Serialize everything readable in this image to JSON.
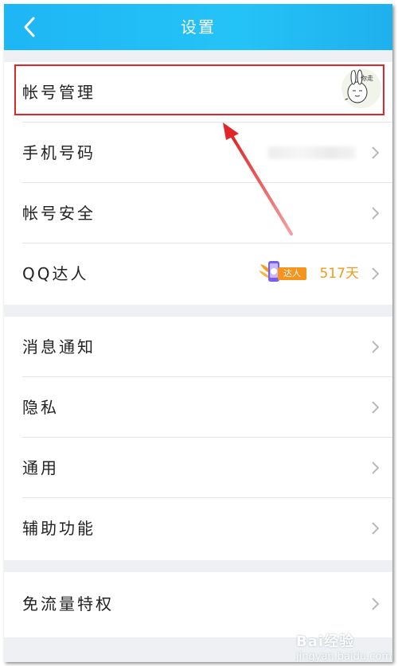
{
  "header": {
    "title": "设置"
  },
  "sections": [
    {
      "rows": [
        {
          "label": "帐号管理",
          "avatar_text": "你走"
        },
        {
          "label": "手机号码"
        },
        {
          "label": "帐号安全"
        },
        {
          "label": "QQ达人",
          "badge_label": "达人",
          "days": "517天"
        }
      ]
    },
    {
      "rows": [
        {
          "label": "消息通知"
        },
        {
          "label": "隐私"
        },
        {
          "label": "通用"
        },
        {
          "label": "辅助功能"
        }
      ]
    },
    {
      "rows": [
        {
          "label": "免流量特权"
        }
      ]
    }
  ],
  "watermark": {
    "brand": "Bai",
    "brand2": "经验",
    "sub": "jingyan.baidu.com"
  },
  "colors": {
    "header": "#1eb6f5",
    "highlight": "#e0262a",
    "accent": "#f29b1d"
  }
}
